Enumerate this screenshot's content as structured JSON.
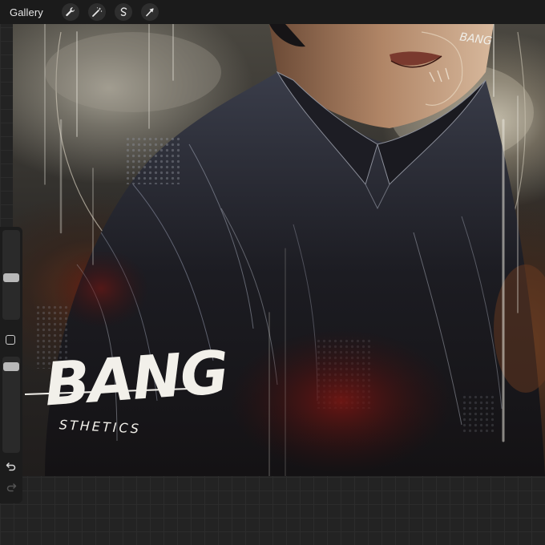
{
  "toolbar": {
    "gallery_label": "Gallery",
    "tools": [
      {
        "name": "actions",
        "icon": "wrench-icon"
      },
      {
        "name": "adjustments",
        "icon": "magic-wand-icon"
      },
      {
        "name": "selection",
        "icon": "selection-s-icon"
      },
      {
        "name": "transform",
        "icon": "arrow-cursor-icon"
      }
    ]
  },
  "sidebar": {
    "brush_size_slider": {
      "level": 0.5
    },
    "opacity_slider": {
      "level": 0.95
    },
    "modify_button": "square-icon",
    "undo": "undo-icon",
    "redo": "redo-icon"
  },
  "artwork": {
    "signature_text": "BANG",
    "logo_main": "BANG",
    "logo_sub": "STHETICS"
  },
  "colors": {
    "toolbar_bg": "#1b1b1b",
    "sidebar_bg": "#1c1c1c",
    "workspace_bg": "#232323",
    "slider_thumb": "#b9b9b9",
    "toolbar_text": "#e6e6e6"
  }
}
